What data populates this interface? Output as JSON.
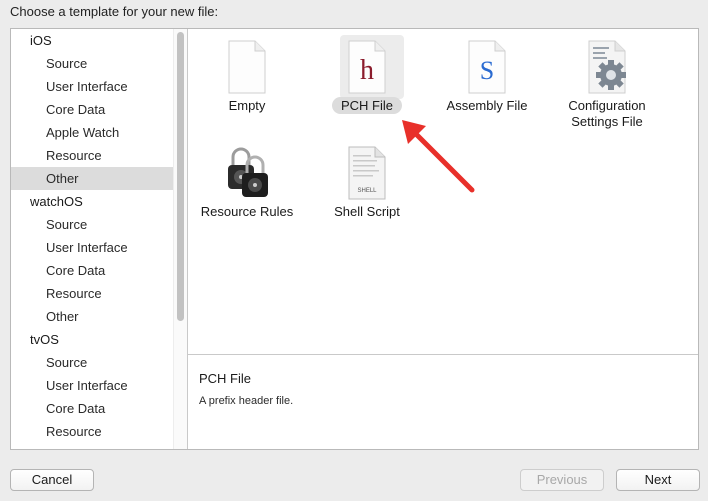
{
  "dialog": {
    "heading": "Choose a template for your new file:"
  },
  "sidebar": {
    "groups": [
      {
        "header": "iOS",
        "items": [
          "Source",
          "User Interface",
          "Core Data",
          "Apple Watch",
          "Resource",
          "Other"
        ]
      },
      {
        "header": "watchOS",
        "items": [
          "Source",
          "User Interface",
          "Core Data",
          "Resource",
          "Other"
        ]
      },
      {
        "header": "tvOS",
        "items": [
          "Source",
          "User Interface",
          "Core Data",
          "Resource"
        ]
      }
    ],
    "selected": "iOS / Other"
  },
  "templates": [
    {
      "icon": "blank-document-icon",
      "label": "Empty",
      "selected": false
    },
    {
      "icon": "header-file-h-icon",
      "label": "PCH File",
      "glyph": "h",
      "glyph_color": "#8b1c2c",
      "selected": true
    },
    {
      "icon": "source-file-s-icon",
      "label": "Assembly File",
      "glyph": "S",
      "glyph_color": "#2a6bd1",
      "selected": false
    },
    {
      "icon": "settings-gear-file-icon",
      "label": "Configuration Settings File",
      "label_line1": "Configuration",
      "label_line2": "Settings File",
      "selected": false
    },
    {
      "icon": "padlocks-icon",
      "label": "Resource Rules",
      "selected": false
    },
    {
      "icon": "shell-script-file-icon",
      "label": "Shell Script",
      "glyph": "SHELL",
      "selected": false
    }
  ],
  "description": {
    "title": "PCH File",
    "text": "A prefix header file."
  },
  "buttons": {
    "cancel": "Cancel",
    "previous": "Previous",
    "next": "Next"
  },
  "annotation": {
    "arrow_color": "#e8302a",
    "points_to": "PCH File"
  }
}
